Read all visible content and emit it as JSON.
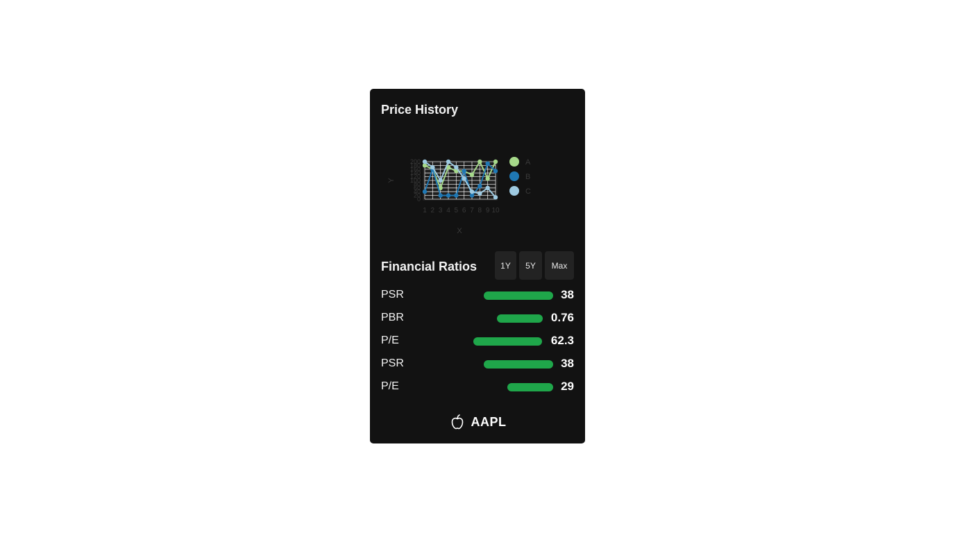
{
  "card": {
    "title": "Price History"
  },
  "chart_data": {
    "type": "line",
    "x": [
      1,
      2,
      3,
      4,
      5,
      6,
      7,
      8,
      9,
      10
    ],
    "xlabel": "X",
    "ylabel": "Y",
    "yticks": [
      0,
      20,
      40,
      60,
      80,
      100,
      120,
      140,
      160,
      180,
      200
    ],
    "ylim": [
      0,
      200
    ],
    "grid": true,
    "legend": "right",
    "series": [
      {
        "name": "A",
        "color": "#a6d98a",
        "values": [
          180,
          160,
          60,
          170,
          150,
          150,
          130,
          200,
          110,
          200
        ]
      },
      {
        "name": "B",
        "color": "#1f78b4",
        "values": [
          40,
          160,
          20,
          20,
          20,
          150,
          20,
          70,
          190,
          150
        ]
      },
      {
        "name": "C",
        "color": "#9ecae1",
        "values": [
          200,
          170,
          100,
          210,
          170,
          110,
          40,
          30,
          60,
          10
        ]
      }
    ]
  },
  "ratios": {
    "title": "Financial Ratios",
    "buttons": {
      "one_year": "1Y",
      "five_year": "5Y",
      "max": "Max"
    },
    "bar_color": "#1fa64a",
    "rows": [
      {
        "label": "PSR",
        "value": "38"
      },
      {
        "label": "PBR",
        "value": "0.76"
      },
      {
        "label": "P/E",
        "value": "62.3"
      },
      {
        "label": "PSR",
        "value": "38"
      },
      {
        "label": "P/E",
        "value": "29"
      }
    ]
  },
  "footer": {
    "icon": "apple-icon",
    "ticker": "AAPL"
  }
}
